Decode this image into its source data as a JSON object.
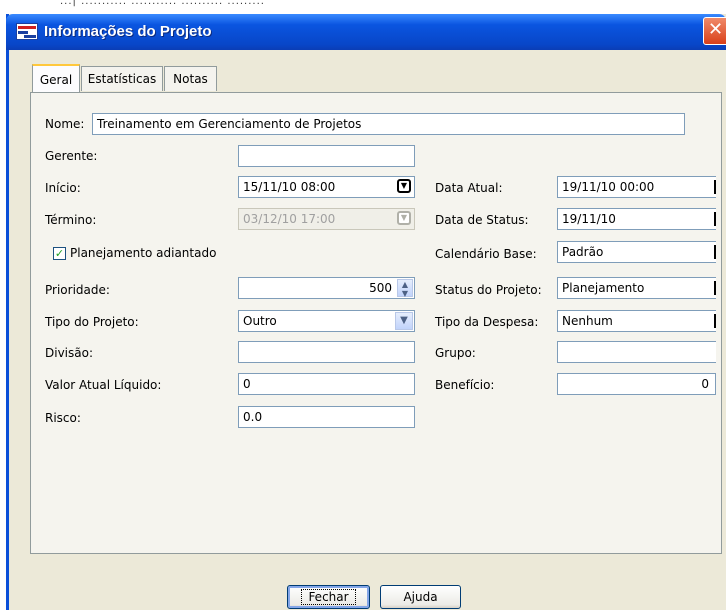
{
  "window": {
    "title": "Informações do Projeto",
    "background_text": "...|  ...........  ...........  ..........  .........",
    "accent": "#0a55e0",
    "close_glyph": "✕"
  },
  "tabs": [
    {
      "label": "Geral",
      "active": true
    },
    {
      "label": "Estatísticas",
      "active": false
    },
    {
      "label": "Notas",
      "active": false
    }
  ],
  "form": {
    "nome": {
      "label": "Nome:",
      "value": "Treinamento em Gerenciamento de Projetos"
    },
    "gerente": {
      "label": "Gerente:",
      "value": ""
    },
    "inicio": {
      "label": "Início:",
      "value": "15/11/10 08:00",
      "icon": "dropdown-icon"
    },
    "termino": {
      "label": "Término:",
      "value": "03/12/10 17:00",
      "icon": "dropdown-icon",
      "disabled": true
    },
    "planejamento": {
      "label": "Planejamento adiantado",
      "checked": true
    },
    "prioridade": {
      "label": "Prioridade:",
      "value": "500"
    },
    "tipo_projeto": {
      "label": "Tipo do Projeto:",
      "value": "Outro"
    },
    "divisao": {
      "label": "Divisão:",
      "value": ""
    },
    "valor_atual": {
      "label": "Valor Atual Líquido:",
      "value": "0"
    },
    "risco": {
      "label": "Risco:",
      "value": "0.0"
    },
    "data_atual": {
      "label": "Data Atual:",
      "value": "19/11/10 00:00"
    },
    "data_status": {
      "label": "Data de Status:",
      "value": "19/11/10"
    },
    "calendario": {
      "label": "Calendário Base:",
      "value": "Padrão"
    },
    "status_projeto": {
      "label": "Status do Projeto:",
      "value": "Planejamento"
    },
    "tipo_despesa": {
      "label": "Tipo da Despesa:",
      "value": "Nenhum"
    },
    "grupo": {
      "label": "Grupo:",
      "value": ""
    },
    "beneficio": {
      "label": "Benefício:",
      "value": "0"
    }
  },
  "buttons": {
    "fechar": "Fechar",
    "ajuda": "Ajuda"
  }
}
